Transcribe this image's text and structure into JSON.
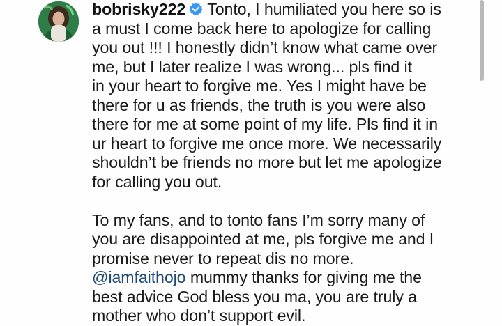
{
  "post": {
    "username": "bobrisky222",
    "verified_icon": "verified-badge-icon",
    "paragraph1_lines": [
      "Tonto, I humiliated you here so is",
      "a must I come back here to apologize for calling",
      "you out !!! I honestly didn’t know what came over",
      "me, but I later realize I was wrong... pls find it",
      "in your heart to forgive me. Yes I might have be",
      "there for u as friends, the truth is you were also",
      "there for me at some point of my life. Pls find it in",
      "ur heart to forgive me once more. We necessarily",
      "shouldn’t be friends no more but let me apologize",
      "for calling you out."
    ],
    "paragraph2_lines": [
      "To my fans, and to tonto fans I’m sorry many of",
      "you are disappointed at me, pls forgive me and I",
      "promise never to repeat dis no more."
    ],
    "mention": "@iamfaithojo",
    "mention_rest": " mummy thanks for giving me the",
    "paragraph2_tail_lines": [
      "best advice God bless you ma, you are truly a",
      "mother who don’t support evil."
    ]
  },
  "colors": {
    "mention": "#1f4a78",
    "badge": "#3897f0"
  }
}
